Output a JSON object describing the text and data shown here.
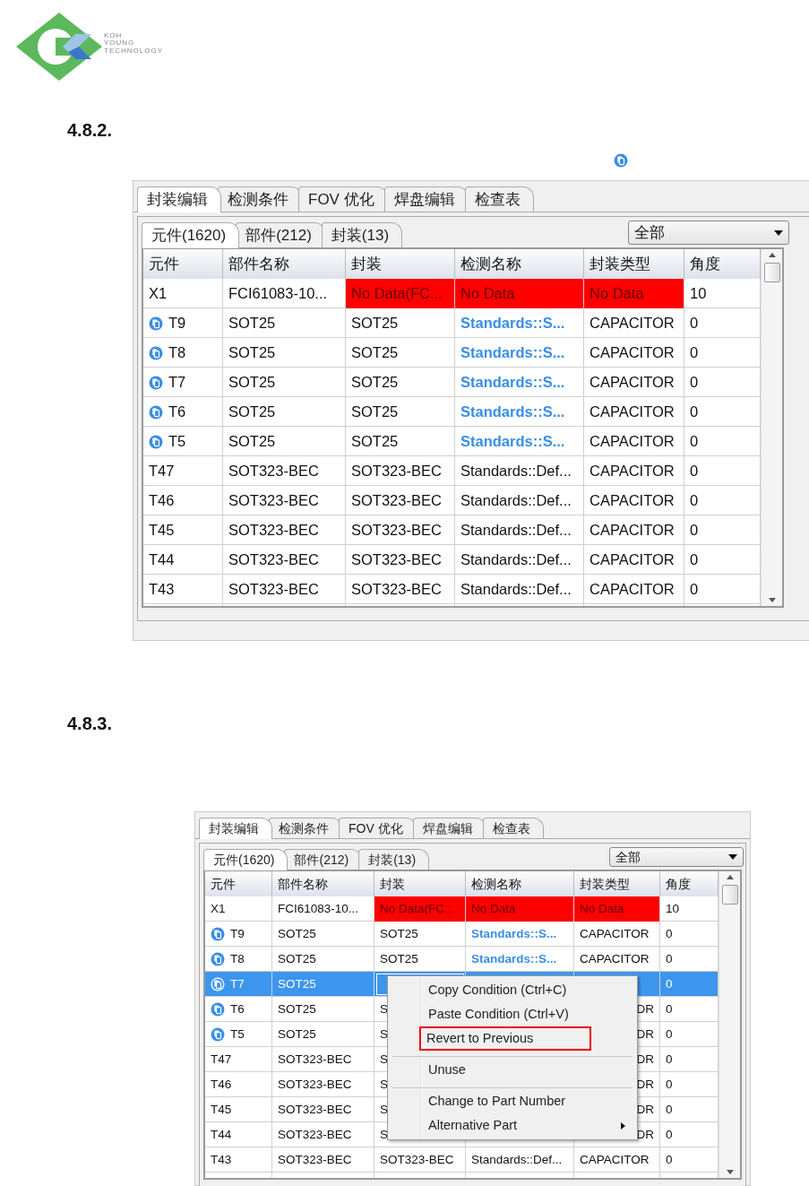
{
  "logo": {
    "lines": [
      "KOH",
      "YOUNG",
      "TECHNOLOGY"
    ]
  },
  "sections": [
    {
      "heading": "4.8.2.",
      "shows_icon": true,
      "panel": {
        "tabs": [
          {
            "label": "封装编辑",
            "selected": true
          },
          {
            "label": "检测条件",
            "selected": false
          },
          {
            "label": "FOV 优化",
            "selected": false
          },
          {
            "label": "焊盘编辑",
            "selected": false
          },
          {
            "label": "检查表",
            "selected": false
          }
        ],
        "subtabs": [
          {
            "label": "元件(1620)",
            "selected": true
          },
          {
            "label": "部件(212)",
            "selected": false
          },
          {
            "label": "封装(13)",
            "selected": false
          }
        ],
        "dropdown": {
          "value": "全部"
        },
        "columns": [
          "元件",
          "部件名称",
          "封装",
          "检测名称",
          "封装类型",
          "角度"
        ],
        "rows": [
          {
            "kind": "error",
            "selected": false,
            "cells": [
              "X1",
              "FCI61083-10...",
              "No Data(FC...",
              "No Data",
              "No Data",
              "10"
            ]
          },
          {
            "kind": "linked",
            "selected": false,
            "cells": [
              "T9",
              "SOT25",
              "SOT25",
              "Standards::S...",
              "CAPACITOR",
              "0"
            ]
          },
          {
            "kind": "linked",
            "selected": false,
            "cells": [
              "T8",
              "SOT25",
              "SOT25",
              "Standards::S...",
              "CAPACITOR",
              "0"
            ]
          },
          {
            "kind": "linked",
            "selected": false,
            "cells": [
              "T7",
              "SOT25",
              "SOT25",
              "Standards::S...",
              "CAPACITOR",
              "0"
            ]
          },
          {
            "kind": "linked",
            "selected": false,
            "cells": [
              "T6",
              "SOT25",
              "SOT25",
              "Standards::S...",
              "CAPACITOR",
              "0"
            ]
          },
          {
            "kind": "linked",
            "selected": false,
            "cells": [
              "T5",
              "SOT25",
              "SOT25",
              "Standards::S...",
              "CAPACITOR",
              "0"
            ]
          },
          {
            "kind": "plain",
            "selected": false,
            "cells": [
              "T47",
              "SOT323-BEC",
              "SOT323-BEC",
              "Standards::Def...",
              "CAPACITOR",
              "0"
            ]
          },
          {
            "kind": "plain",
            "selected": false,
            "cells": [
              "T46",
              "SOT323-BEC",
              "SOT323-BEC",
              "Standards::Def...",
              "CAPACITOR",
              "0"
            ]
          },
          {
            "kind": "plain",
            "selected": false,
            "cells": [
              "T45",
              "SOT323-BEC",
              "SOT323-BEC",
              "Standards::Def...",
              "CAPACITOR",
              "0"
            ]
          },
          {
            "kind": "plain",
            "selected": false,
            "cells": [
              "T44",
              "SOT323-BEC",
              "SOT323-BEC",
              "Standards::Def...",
              "CAPACITOR",
              "0"
            ]
          },
          {
            "kind": "plain",
            "selected": false,
            "cells": [
              "T43",
              "SOT323-BEC",
              "SOT323-BEC",
              "Standards::Def...",
              "CAPACITOR",
              "0"
            ]
          }
        ]
      }
    },
    {
      "heading": "4.8.3.",
      "shows_icon": false,
      "panel": {
        "tabs": [
          {
            "label": "封装编辑",
            "selected": true
          },
          {
            "label": "检测条件",
            "selected": false
          },
          {
            "label": "FOV 优化",
            "selected": false
          },
          {
            "label": "焊盘编辑",
            "selected": false
          },
          {
            "label": "检查表",
            "selected": false
          }
        ],
        "subtabs": [
          {
            "label": "元件(1620)",
            "selected": true
          },
          {
            "label": "部件(212)",
            "selected": false
          },
          {
            "label": "封装(13)",
            "selected": false
          }
        ],
        "dropdown": {
          "value": "全部"
        },
        "columns": [
          "元件",
          "部件名称",
          "封装",
          "检测名称",
          "封装类型",
          "角度"
        ],
        "rows": [
          {
            "kind": "error",
            "selected": false,
            "cells": [
              "X1",
              "FCI61083-10...",
              "No Data(FC...",
              "No Data",
              "No Data",
              "10"
            ]
          },
          {
            "kind": "linked",
            "selected": false,
            "cells": [
              "T9",
              "SOT25",
              "SOT25",
              "Standards::S...",
              "CAPACITOR",
              "0"
            ]
          },
          {
            "kind": "linked",
            "selected": false,
            "cells": [
              "T8",
              "SOT25",
              "SOT25",
              "Standards::S...",
              "CAPACITOR",
              "0"
            ]
          },
          {
            "kind": "linked",
            "selected": true,
            "cells": [
              "T7",
              "SOT25",
              null,
              null,
              null,
              "0"
            ]
          },
          {
            "kind": "linked",
            "selected": false,
            "cells": [
              "T6",
              "SOT25",
              "S",
              null,
              null,
              "0"
            ],
            "type_tail": "DR"
          },
          {
            "kind": "linked",
            "selected": false,
            "cells": [
              "T5",
              "SOT25",
              "S",
              null,
              null,
              "0"
            ],
            "type_tail": "DR"
          },
          {
            "kind": "plain",
            "selected": false,
            "cells": [
              "T47",
              "SOT323-BEC",
              "S",
              null,
              null,
              "0"
            ],
            "type_tail": "DR"
          },
          {
            "kind": "plain",
            "selected": false,
            "cells": [
              "T46",
              "SOT323-BEC",
              "S",
              null,
              null,
              "0"
            ],
            "type_tail": "DR"
          },
          {
            "kind": "plain",
            "selected": false,
            "cells": [
              "T45",
              "SOT323-BEC",
              "S",
              null,
              null,
              "0"
            ],
            "type_tail": "DR"
          },
          {
            "kind": "plain",
            "selected": false,
            "cells": [
              "T44",
              "SOT323-BEC",
              "S",
              null,
              null,
              "0"
            ],
            "type_tail": "DR"
          },
          {
            "kind": "plain",
            "selected": false,
            "cells": [
              "T43",
              "SOT323-BEC",
              "SOT323-BEC",
              "Standards::Def...",
              "CAPACITOR",
              "0"
            ]
          }
        ],
        "context_menu": {
          "items": [
            {
              "label": "Copy Condition (Ctrl+C)",
              "separator_before": false,
              "highlighted": false,
              "submenu": false
            },
            {
              "label": "Paste Condition (Ctrl+V)",
              "separator_before": false,
              "highlighted": false,
              "submenu": false
            },
            {
              "label": "Revert to Previous",
              "separator_before": false,
              "highlighted": true,
              "submenu": false
            },
            {
              "label": "Unuse",
              "separator_before": true,
              "highlighted": false,
              "submenu": false
            },
            {
              "label": "Change to Part Number",
              "separator_before": true,
              "highlighted": false,
              "submenu": false
            },
            {
              "label": "Alternative Part",
              "separator_before": false,
              "highlighted": false,
              "submenu": true
            }
          ]
        }
      }
    }
  ]
}
